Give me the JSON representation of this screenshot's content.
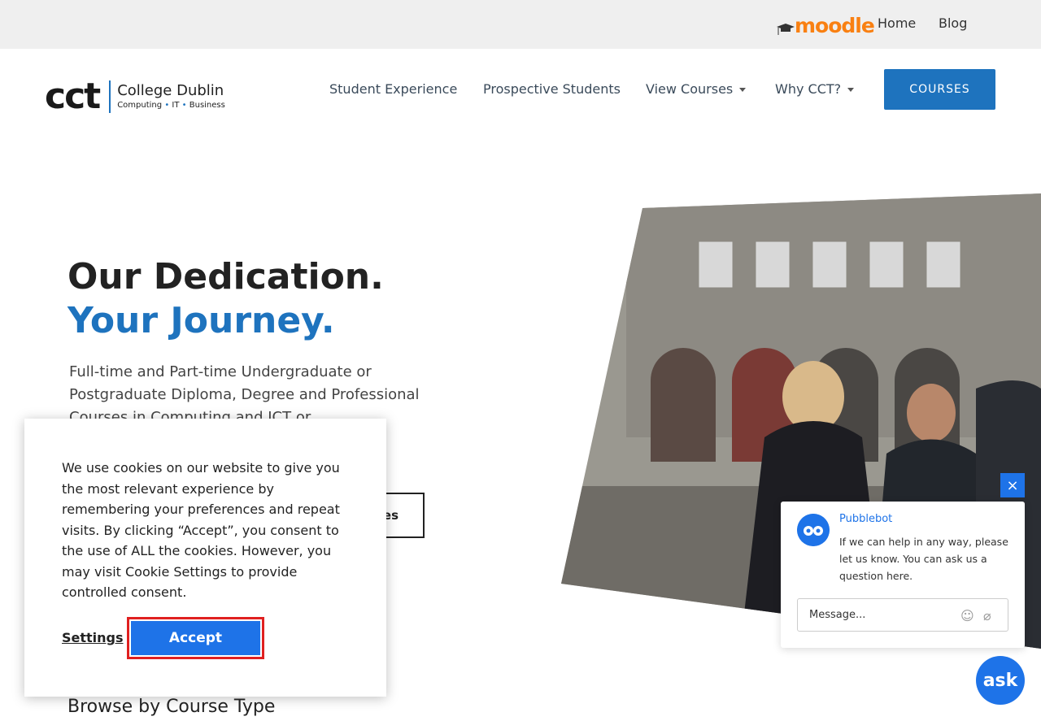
{
  "topbar": {
    "moodle_label": "moodle",
    "links": [
      {
        "label": "Home"
      },
      {
        "label": "Blog"
      }
    ]
  },
  "header": {
    "logo": {
      "mark": "cct",
      "name": "College Dublin",
      "sub1": "Computing",
      "sub2": "IT",
      "sub3": "Business"
    },
    "nav": [
      {
        "label": "Student Experience",
        "has_dropdown": false
      },
      {
        "label": "Prospective Students",
        "has_dropdown": false
      },
      {
        "label": "View Courses",
        "has_dropdown": true
      },
      {
        "label": "Why CCT?",
        "has_dropdown": true
      }
    ],
    "courses_button": "COURSES"
  },
  "hero": {
    "title_line1": "Our Dedication.",
    "title_line2": "Your Journey.",
    "description": "Full-time and Part-time Undergraduate or Postgraduate Diploma, Degree and Professional Courses in Computing and ICT or",
    "button_partial": "es"
  },
  "cookie_banner": {
    "text": "We use cookies on our website to give you the most relevant experience by remembering your preferences and repeat visits. By clicking “Accept”, you consent to the use of ALL the cookies. However, you may visit Cookie Settings to provide controlled consent.",
    "settings_label": "Settings",
    "accept_label": "Accept"
  },
  "browse": {
    "heading": "Browse by Course Type"
  },
  "chat": {
    "close_label": "×",
    "bot_name": "Pubblebot",
    "message": "If we can help in any way, please let us know. You can ask us a question here.",
    "input_placeholder": "Message...",
    "ask_label": "ask"
  },
  "colors": {
    "brand_blue": "#1e73be",
    "chat_blue": "#1e73e8",
    "moodle_orange": "#f98012",
    "highlight_red": "#e02020"
  },
  "icons": [
    "graduation-cap-icon",
    "chevron-down-icon",
    "close-icon",
    "bot-avatar-icon",
    "emoji-icon",
    "attachment-icon"
  ]
}
